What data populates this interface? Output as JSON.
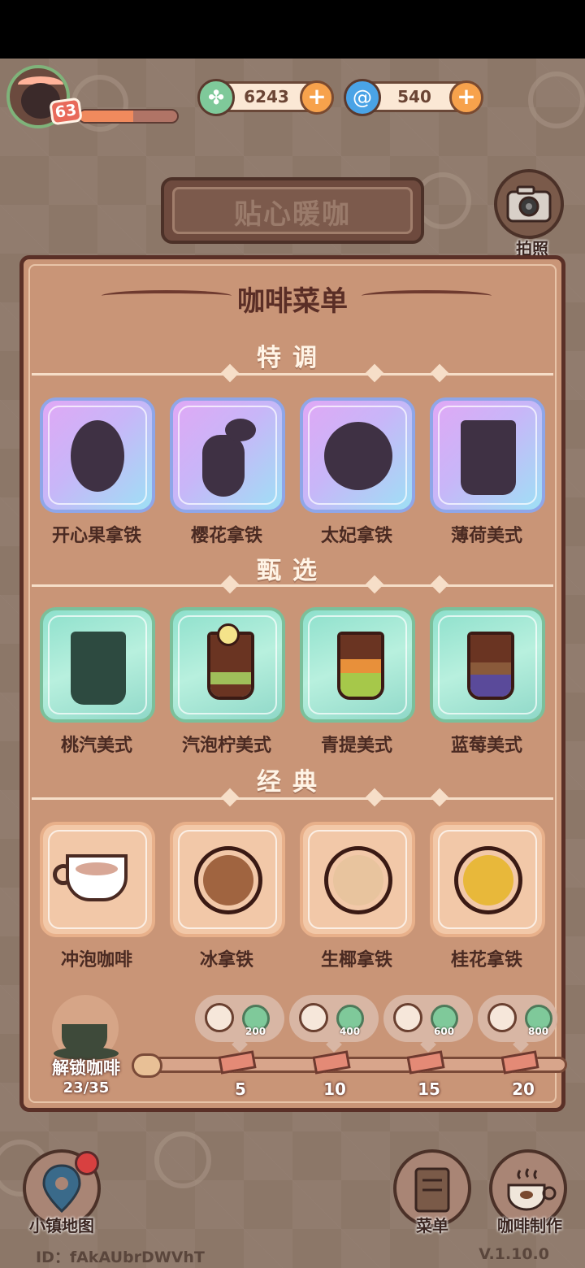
{
  "player": {
    "level": "63",
    "xp_fraction": 0.55
  },
  "currencies": [
    {
      "name": "clover",
      "icon": "clover-icon",
      "value": "6243",
      "color": "#7fc99a"
    },
    {
      "name": "gem",
      "icon": "swirl-icon",
      "value": "540",
      "color": "#4aa3e6"
    }
  ],
  "shop_sign": "贴心暖咖",
  "camera_label": "拍照",
  "menu": {
    "title": "咖啡菜单",
    "sections": [
      {
        "title": "特调",
        "items": [
          "开心果拿铁",
          "樱花拿铁",
          "太妃拿铁",
          "薄荷美式"
        ]
      },
      {
        "title": "甄选",
        "items": [
          "桃汽美式",
          "汽泡柠美式",
          "青提美式",
          "蓝莓美式"
        ]
      },
      {
        "title": "经典",
        "items": [
          "冲泡咖啡",
          "冰拿铁",
          "生椰拿铁",
          "桂花拿铁"
        ]
      }
    ]
  },
  "unlock": {
    "label": "解锁咖啡",
    "count": "23/35",
    "rewards": [
      {
        "amount": "200",
        "milestone": "5"
      },
      {
        "amount": "400",
        "milestone": "10"
      },
      {
        "amount": "600",
        "milestone": "15"
      },
      {
        "amount": "800",
        "milestone": "20"
      }
    ]
  },
  "bottom_nav": {
    "map": "小镇地图",
    "menu": "菜单",
    "make": "咖啡制作"
  },
  "footer": {
    "id": "ID：fAkAUbrDWVhT",
    "version": "V.1.10.0"
  }
}
